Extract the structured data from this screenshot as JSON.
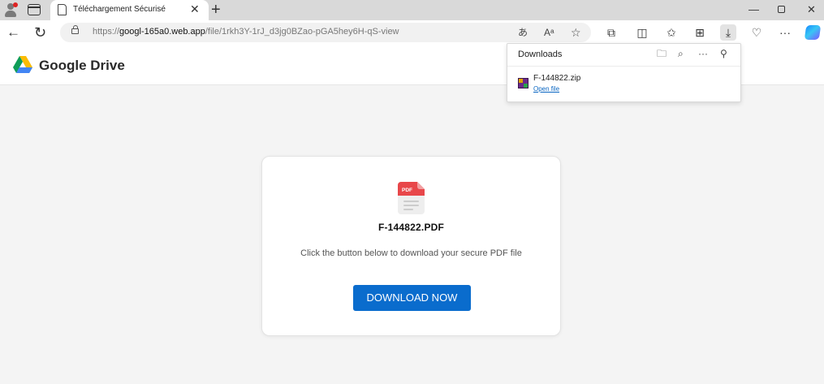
{
  "browser": {
    "tab_title": "Téléchargement Sécurisé",
    "tab_close": "✕",
    "new_tab": "+",
    "url_prefix": "https://",
    "url_host": "googl-165a0.web.app",
    "url_path": "/file/1rkh3Y-1rJ_d3jg0BZao-pGA5hey6H-qS-view",
    "window_controls": {
      "minimize": "—",
      "close": "✕"
    }
  },
  "header": {
    "brand": "Google Drive"
  },
  "downloads_panel": {
    "title": "Downloads",
    "items": [
      {
        "filename": "F-144822.zip",
        "action": "Open file"
      }
    ]
  },
  "card": {
    "filename": "F-144822.PDF",
    "description": "Click the button below to download your secure PDF file",
    "button_label": "DOWNLOAD NOW",
    "pdf_badge": "PDF"
  },
  "colors": {
    "accent": "#0a6ccd",
    "pdf_red": "#e8474a",
    "link": "#0a66c2"
  }
}
